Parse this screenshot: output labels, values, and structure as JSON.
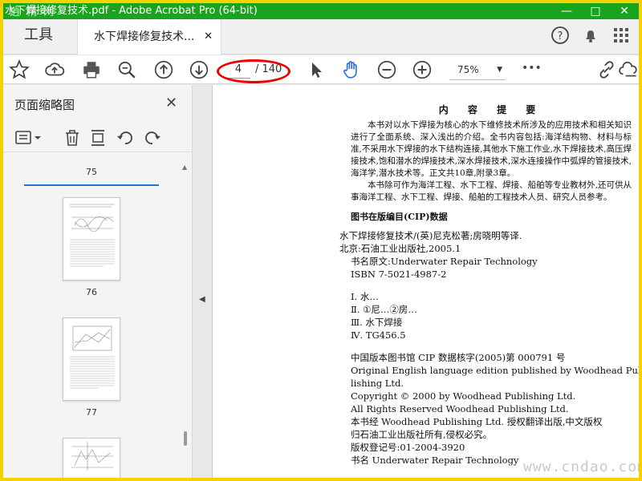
{
  "window": {
    "title": "水下焊接修复技术.pdf - Adobe Acrobat Pro (64-bit)",
    "watermark_top": "逍 精 网",
    "controls": [
      "—",
      "□",
      "✕"
    ]
  },
  "tabs": {
    "tools_label": "工具",
    "doc_tab_label": "水下焊接修复技术...",
    "doc_tab_close": "✕"
  },
  "toolbar": {
    "page_current": "4",
    "page_total": "/ 140",
    "zoom": "75%",
    "zoom_caret": "▼",
    "more": "•••"
  },
  "panel": {
    "title": "页面缩略图",
    "close": "✕",
    "pages": [
      "75",
      "76",
      "77"
    ]
  },
  "document": {
    "heading": "内 容 提 要",
    "paragraphs": [
      "本书对以水下焊接为核心的水下维修技术所涉及的应用技术和相关知识进行了全面系统、深入浅出的介绍。全书内容包括:海洋结构物、材料与标准,不采用水下焊接的水下结构连接,其他水下施工作业,水下焊接技术,高压焊接技术,饱和潜水的焊接技术,深水焊接技术,深水连接操作中弧焊的管接技术,海洋学,潜水技术等。正文共10章,附录3章。",
      "本书除可作为海洋工程、水下工程、焊接、船舶等专业教材外,还可供从事海洋工程、水下工程、焊接、船舶的工程技术人员、研究人员参考。"
    ],
    "cip_title": "图书在版编目(CIP)数据",
    "cip_lines": [
      "水下焊接修复技术/(英)尼克松著;房晓明等译.",
      "北京:石油工业出版社,2005.1",
      "书名原文:Underwater Repair Technology",
      "ISBN 7-5021-4987-2"
    ],
    "class_lines": [
      "Ⅰ. 水…",
      "Ⅱ. ①尼…②房…",
      "Ⅲ. 水下焊接",
      "Ⅳ. TG456.5"
    ],
    "copyright_lines": [
      "中国版本图书馆 CIP 数据核字(2005)第 000791 号",
      "Original English language edition published by Woodhead Pub-",
      "lishing Ltd.",
      "Copyright © 2000 by Woodhead Publishing Ltd.",
      "All Rights Reserved Woodhead Publishing Ltd.",
      "本书经 Woodhead Publishing Ltd. 授权翻译出版,中文版权",
      "归石油工业出版社所有,侵权必究。",
      "版权登记号:01-2004-3920",
      "书名 Underwater Repair Technology"
    ]
  },
  "watermark_bottom": "www.cndao.com",
  "colors": {
    "titlebar": "#19a31e",
    "frame": "#f2d300",
    "highlight": "#e00000",
    "selection": "#2c6fd1"
  }
}
